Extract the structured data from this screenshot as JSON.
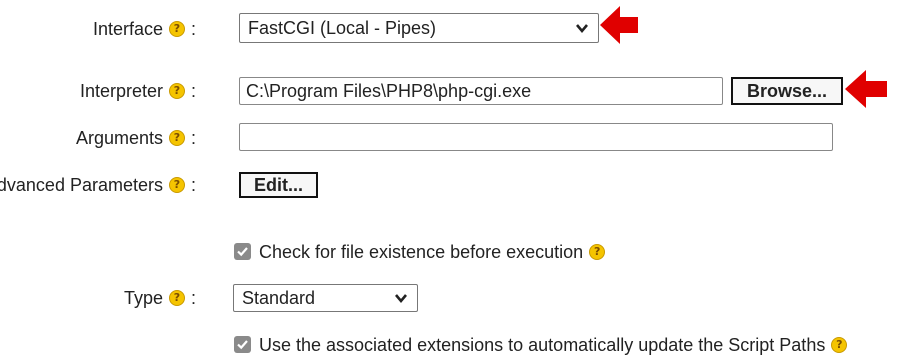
{
  "colors": {
    "help_badge": "#f5c400",
    "arrow": "#e00000",
    "checkbox": "#8a8a8a"
  },
  "interface": {
    "label": "Interface",
    "help_icon": "?",
    "colon": ":",
    "selected": "FastCGI (Local - Pipes)"
  },
  "interpreter": {
    "label": "Interpreter",
    "help_icon": "?",
    "colon": ":",
    "value": "C:\\Program Files\\PHP8\\php-cgi.exe",
    "browse_label": "Browse..."
  },
  "arguments": {
    "label": "Arguments",
    "help_icon": "?",
    "colon": ":",
    "value": ""
  },
  "advanced": {
    "label": "Advanced Parameters",
    "help_icon": "?",
    "colon": ":",
    "edit_label": "Edit..."
  },
  "check_existence": {
    "checked": true,
    "label": "Check for file existence before execution",
    "help_icon": "?"
  },
  "type": {
    "label": "Type",
    "help_icon": "?",
    "colon": ":",
    "selected": "Standard"
  },
  "use_extensions": {
    "checked": true,
    "label": "Use the associated extensions to automatically update the Script Paths",
    "help_icon": "?"
  }
}
